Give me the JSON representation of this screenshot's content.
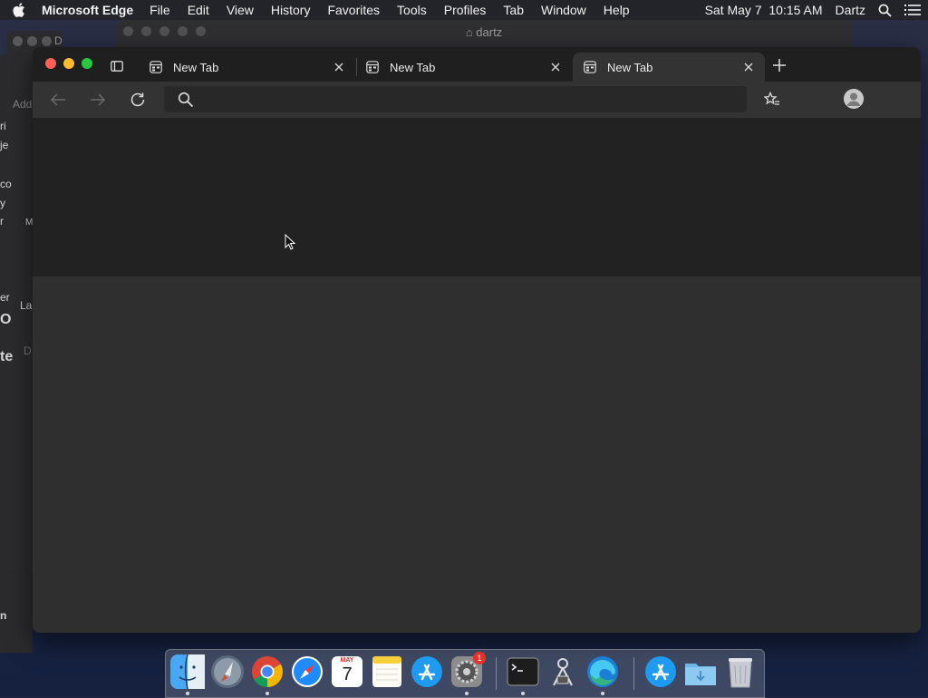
{
  "menubar": {
    "app_name": "Microsoft Edge",
    "items": [
      "File",
      "Edit",
      "View",
      "History",
      "Favorites",
      "Tools",
      "Profiles",
      "Tab",
      "Window",
      "Help"
    ],
    "datetime": "Sat May 7  10:15 AM",
    "user": "Dartz"
  },
  "background_window": {
    "title": "dartz",
    "left_window_title": "Doc"
  },
  "background_fragments": [
    "Add",
    "ri",
    "je",
    "co",
    "y",
    "r",
    "M",
    "er",
    "La",
    "O",
    "D",
    "te",
    "n"
  ],
  "browser": {
    "tabs": [
      {
        "label": "New Tab",
        "active": false
      },
      {
        "label": "New Tab",
        "active": false
      },
      {
        "label": "New Tab",
        "active": true
      }
    ],
    "address_bar": {
      "value": "",
      "placeholder": ""
    }
  },
  "dock": {
    "apps": [
      "Finder",
      "Launchpad",
      "Google Chrome",
      "Safari",
      "Calendar",
      "Notes",
      "App Store",
      "System Preferences",
      "Terminal",
      "Automator",
      "Microsoft Edge",
      "App Store",
      "Downloads",
      "Trash"
    ],
    "calendar": {
      "month": "MAY",
      "day": "7"
    },
    "system_prefs_badge": "1"
  },
  "colors": {
    "menubar": "#23232a",
    "tabbar": "#1f1f1f",
    "toolbar": "#333333",
    "content_top": "#222222",
    "content_bottom": "#2f2f2f"
  }
}
